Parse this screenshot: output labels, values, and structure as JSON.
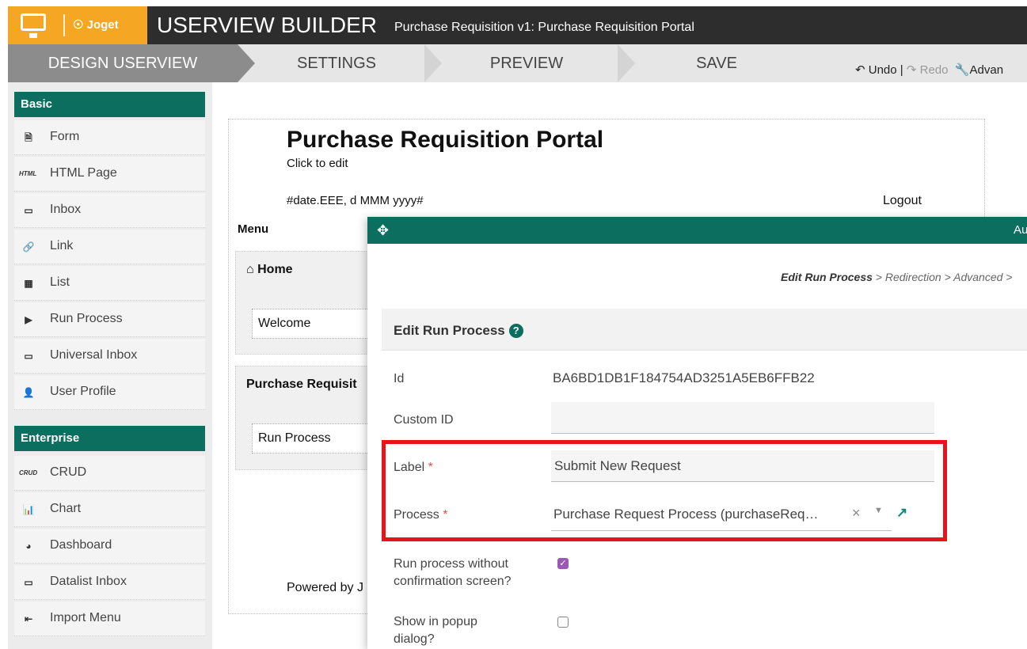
{
  "header": {
    "logo_text": "Joget",
    "title": "USERVIEW BUILDER",
    "subtitle": "Purchase Requisition v1: Purchase Requisition Portal"
  },
  "steps": [
    "DESIGN USERVIEW",
    "SETTINGS",
    "PREVIEW",
    "SAVE"
  ],
  "toolbar": {
    "undo": "Undo",
    "separator": "|",
    "redo": "Redo",
    "advanced": "Advan"
  },
  "palette": {
    "basic_title": "Basic",
    "basic_items": [
      {
        "icon": "form-icon",
        "label": "Form"
      },
      {
        "icon": "html-icon",
        "icon_text": "HTML",
        "label": "HTML Page"
      },
      {
        "icon": "inbox-icon",
        "label": "Inbox"
      },
      {
        "icon": "link-icon",
        "label": "Link"
      },
      {
        "icon": "list-icon",
        "label": "List"
      },
      {
        "icon": "play-icon",
        "label": "Run Process"
      },
      {
        "icon": "inbox-icon",
        "label": "Universal Inbox"
      },
      {
        "icon": "user-edit-icon",
        "label": "User Profile"
      }
    ],
    "enterprise_title": "Enterprise",
    "enterprise_items": [
      {
        "icon": "crud-icon",
        "icon_text": "CRUD",
        "label": "CRUD"
      },
      {
        "icon": "chart-icon",
        "label": "Chart"
      },
      {
        "icon": "dashboard-icon",
        "label": "Dashboard"
      },
      {
        "icon": "inbox-icon",
        "label": "Datalist Inbox"
      },
      {
        "icon": "import-icon",
        "label": "Import Menu"
      }
    ]
  },
  "portal": {
    "title": "Purchase Requisition Portal",
    "subtitle": "Click to edit",
    "date": "#date.EEE, d MMM yyyy#",
    "logout": "Logout",
    "menu_label": "Menu",
    "categories": [
      {
        "label": "Home",
        "item": "Welcome"
      },
      {
        "label": "Purchase Requisit",
        "item": "Run Process"
      }
    ],
    "footer": "Powered by J"
  },
  "dialog": {
    "title_partial": "Au",
    "breadcrumb": {
      "current": "Edit Run Process",
      "rest": " > Redirection > Advanced >"
    },
    "section_title": "Edit Run Process",
    "fields": {
      "id": {
        "label": "Id",
        "value": "BA6BD1DB1F184754AD3251A5EB6FFB22"
      },
      "custom_id": {
        "label": "Custom ID",
        "value": ""
      },
      "label": {
        "label": "Label",
        "required": "*",
        "value": "Submit New Request"
      },
      "process": {
        "label": "Process",
        "required": "*",
        "value": "Purchase Request Process (purchaseReq…"
      },
      "run_without_confirm": {
        "label_line1": "Run process without",
        "label_line2": "confirmation screen?",
        "checked": true
      },
      "popup": {
        "label_line1": "Show in popup",
        "label_line2": "dialog?",
        "checked": false
      }
    }
  },
  "colors": {
    "brand_green": "#0b6e5e",
    "logo_orange": "#f5a623",
    "highlight_red": "#e8141c",
    "checkbox_purple": "#9b59b6"
  }
}
